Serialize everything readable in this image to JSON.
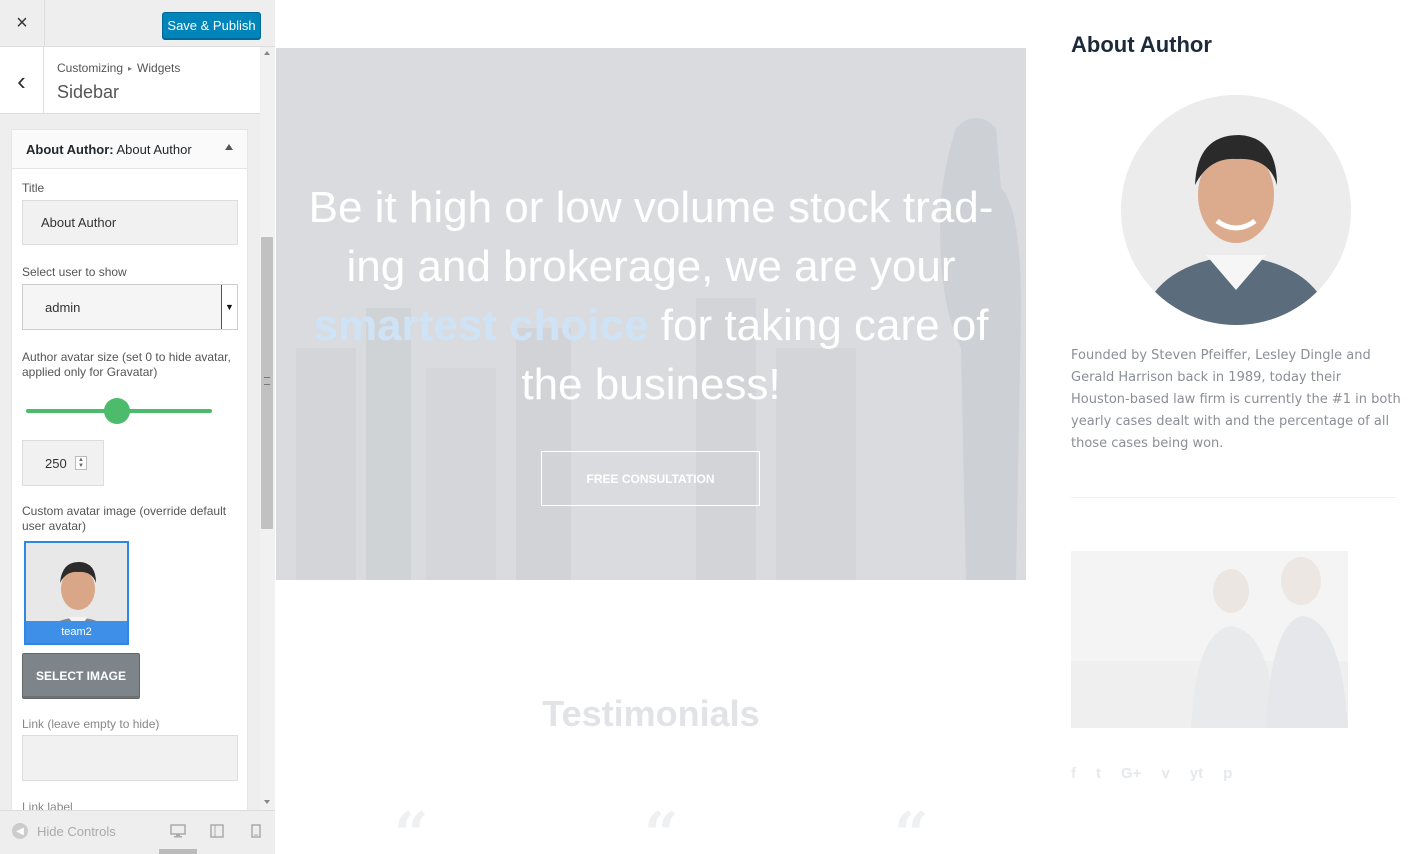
{
  "customizer": {
    "close_icon": "×",
    "publish_label": "Save & Publish",
    "back_icon": "‹",
    "breadcrumb": {
      "root": "Customizing",
      "sep": "▸",
      "current": "Widgets"
    },
    "section_title": "Sidebar",
    "widget": {
      "type": "About Author:",
      "name": "About Author",
      "title_label": "Title",
      "title_value": "About Author",
      "user_label": "Select user to show",
      "user_value": "admin",
      "avatar_size_label": "Author avatar size (set 0 to hide avatar, applied only for Gravatar)",
      "avatar_size_value": "250",
      "slider_level": 0.5,
      "custom_avatar_label": "Custom avatar image (override default user avatar)",
      "avatar_caption": "team2",
      "select_image_label": "SELECT IMAGE",
      "link_label": "Link (leave empty to hide)",
      "link_value": "",
      "link_text_label": "Link label"
    },
    "footer": {
      "hide_controls": "Hide Controls"
    }
  },
  "preview": {
    "hero": {
      "text_before": "Be it high or low volume stock trad-ing and brokerage, we are your ",
      "highlight": "smartest choice",
      "text_after": " for taking care of the business!",
      "cta": "FREE CONSULTATION"
    },
    "testimonials_heading": "Testimonials",
    "quote_glyph": "“",
    "aside": {
      "title": "About Author",
      "bio": "Founded by Steven Pfeiffer, Lesley Dingle and Gerald Harrison back in 1989, today their Houston-based law firm is currently the #1 in both yearly cases dealt with and the percentage of all those cases being won.",
      "social": [
        "f",
        "t",
        "G+",
        "v",
        "yt",
        "p"
      ]
    }
  },
  "colors": {
    "accent": "#0085ba",
    "slider": "#4cbb6c",
    "selected": "#3d8fe8"
  }
}
